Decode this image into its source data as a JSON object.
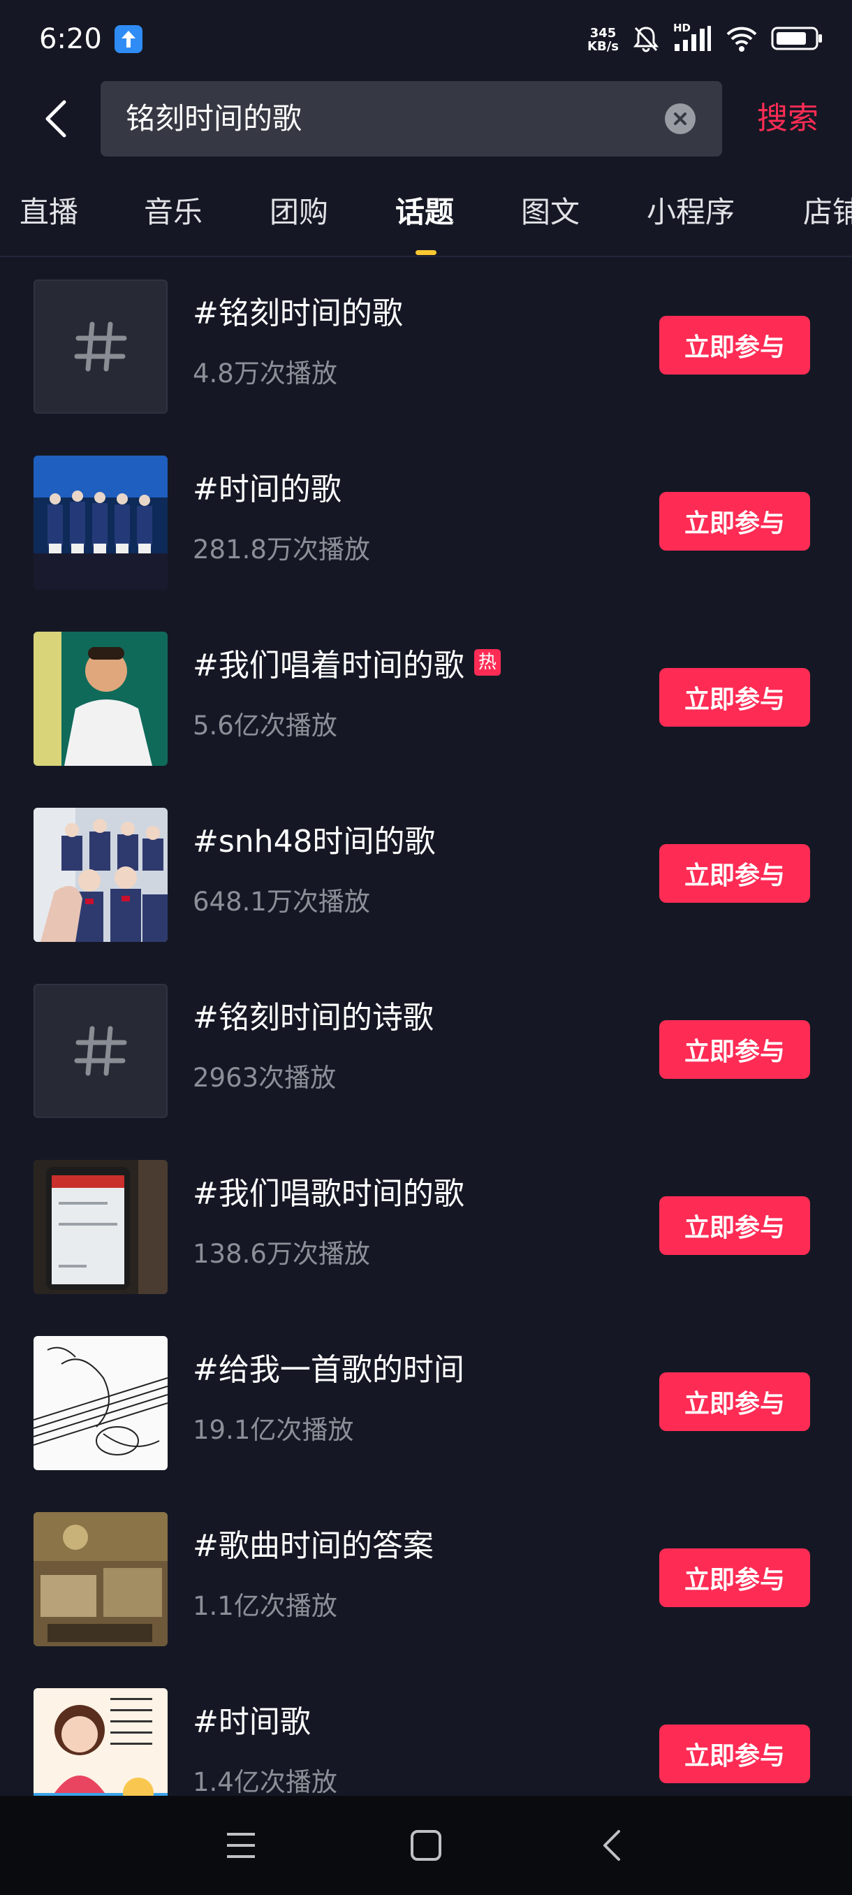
{
  "status_bar": {
    "time": "6:20",
    "net_speed_value": "345",
    "net_speed_unit": "KB/s",
    "network_label": "HD"
  },
  "search": {
    "query": "铭刻时间的歌",
    "submit_label": "搜索"
  },
  "tabs": [
    {
      "label": "直播",
      "active": false
    },
    {
      "label": "音乐",
      "active": false
    },
    {
      "label": "团购",
      "active": false
    },
    {
      "label": "话题",
      "active": true
    },
    {
      "label": "图文",
      "active": false
    },
    {
      "label": "小程序",
      "active": false
    },
    {
      "label": "店铺",
      "active": false
    }
  ],
  "topics": [
    {
      "title": "#铭刻时间的歌",
      "plays": "4.8万次播放",
      "thumb": "hashtag-icon",
      "hot": false
    },
    {
      "title": "#时间的歌",
      "plays": "281.8万次播放",
      "thumb": "stage-performance-image",
      "hot": false
    },
    {
      "title": "#我们唱着时间的歌",
      "plays": "5.6亿次播放",
      "thumb": "singer-portrait-image",
      "hot": true,
      "hot_label": "热"
    },
    {
      "title": "#snh48时间的歌",
      "plays": "648.1万次播放",
      "thumb": "group-photo-image",
      "hot": false
    },
    {
      "title": "#铭刻时间的诗歌",
      "plays": "2963次播放",
      "thumb": "hashtag-icon",
      "hot": false
    },
    {
      "title": "#我们唱歌时间的歌",
      "plays": "138.6万次播放",
      "thumb": "phone-screen-image",
      "hot": false
    },
    {
      "title": "#给我一首歌的时间",
      "plays": "19.1亿次播放",
      "thumb": "guitar-sketch-image",
      "hot": false
    },
    {
      "title": "#歌曲时间的答案",
      "plays": "1.1亿次播放",
      "thumb": "photo-collage-image",
      "hot": false
    },
    {
      "title": "#时间歌",
      "plays": "1.4亿次播放",
      "thumb": "cartoon-girl-image",
      "hot": false
    }
  ],
  "join_label": "立即参与",
  "colors": {
    "background": "#151824",
    "accent": "#fe2c55",
    "tab_indicator": "#fcc832",
    "secondary_text": "#8d8f98"
  }
}
